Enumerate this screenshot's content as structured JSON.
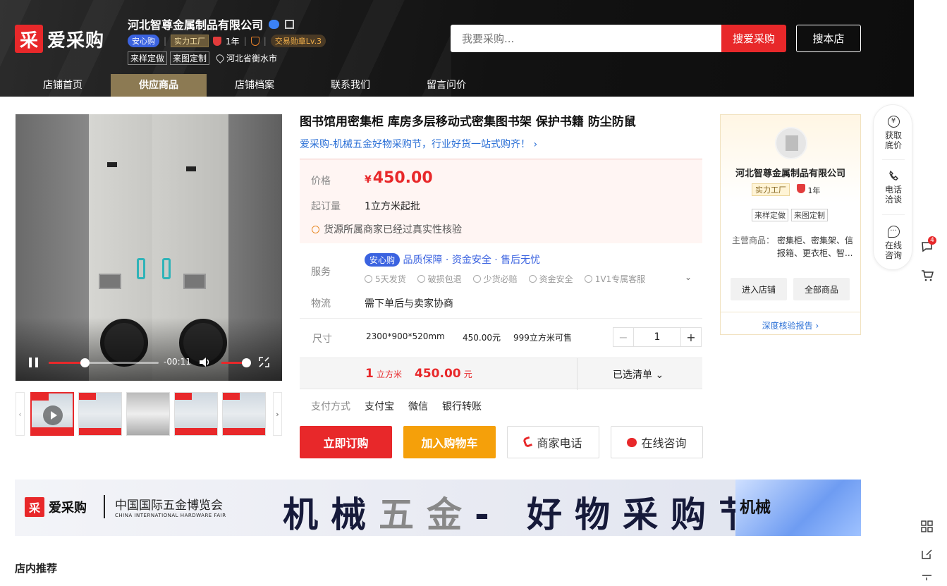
{
  "brand": {
    "logo_mark": "采",
    "logo_text": "爱采购"
  },
  "shop": {
    "name": "河北智尊金属制品有限公司",
    "anxin": "安心购",
    "shili": "实力工厂",
    "years": "1年",
    "medal": "交易勋章Lv.3",
    "tags": [
      "来样定做",
      "来图定制"
    ],
    "location": "河北省衡水市"
  },
  "search": {
    "placeholder": "我要采购...",
    "button": "搜爱采购",
    "shop_button": "搜本店"
  },
  "nav": [
    "店铺首页",
    "供应商品",
    "店铺档案",
    "联系我们",
    "留言问价"
  ],
  "video": {
    "time": "-00:11",
    "progress": 0.33,
    "volume": 0.9
  },
  "product": {
    "title": "图书馆用密集柜 库房多层移动式密集图书架 保护书籍 防尘防鼠",
    "promo": "爱采购-机械五金好物采购节，行业好货一站式购齐！",
    "price_label": "价格",
    "currency": "¥",
    "price": "450.00",
    "moq_label": "起订量",
    "moq": "1立方米起批",
    "verify": "货源所属商家已经过真实性核验",
    "service_label": "服务",
    "service_anxin": "安心购",
    "service_guarantee": "品质保障 · 资金安全 · 售后无忧",
    "service_items": [
      "5天发货",
      "破损包退",
      "少货必赔",
      "资金安全",
      "1V1专属客服"
    ],
    "logistics_label": "物流",
    "logistics": "需下单后与卖家协商",
    "size_label": "尺寸",
    "size_value": "2300*900*520mm",
    "size_price": "450.00元",
    "stock": "999立方米可售",
    "qty": "1",
    "sum_qty": "1",
    "sum_unit": "立方米",
    "sum_price": "450.00",
    "sum_price_unit": "元",
    "selected": "已选清单",
    "pay_label": "支付方式",
    "pay_methods": [
      "支付宝",
      "微信",
      "银行转账"
    ]
  },
  "actions": {
    "order": "立即订购",
    "cart": "加入购物车",
    "phone": "商家电话",
    "chat": "在线咨询"
  },
  "card": {
    "name": "河北智尊金属制品有限公司",
    "shili": "实力工厂",
    "years": "1年",
    "tags": [
      "来样定做",
      "来图定制"
    ],
    "main_label": "主营商品：",
    "main_value": "密集柜、密集架、信报箱、更衣柜、智...",
    "enter": "进入店铺",
    "all": "全部商品",
    "report": "深度核验报告"
  },
  "float": [
    {
      "icon": "¥",
      "label": "获取\n底价"
    },
    {
      "icon": "",
      "label": "电话\n洽谈"
    },
    {
      "icon": "",
      "label": "在线\n咨询"
    }
  ],
  "side_badge": "4",
  "banner": {
    "logo_text": "爱采购",
    "expo": "中国国际五金博览会",
    "expo_en": "CHINA INTERNATIONAL HARDWARE FAIR",
    "slogan_a": "机械",
    "slogan_b": "五金",
    "slogan_c": "- 好物采购节",
    "cube_text": "机械"
  },
  "section": {
    "recommend": "店内推荐"
  }
}
